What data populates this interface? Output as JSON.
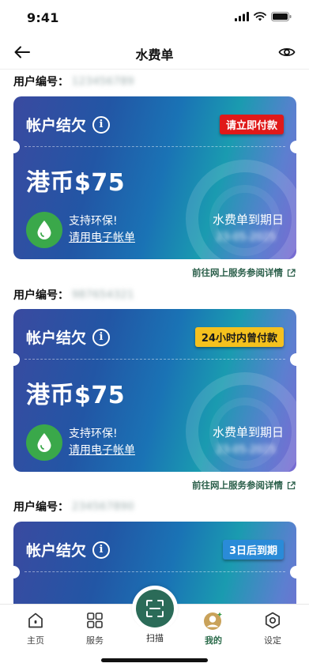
{
  "status_bar": {
    "time": "9:41"
  },
  "header": {
    "title": "水费单",
    "back_icon": "arrow-left-icon",
    "view_icon": "eye-icon"
  },
  "accounts": [
    {
      "label": "用户编号：",
      "number": "123456789",
      "card_title": "帐户结欠",
      "status_badge": "请立即付款",
      "status_color": "#e01919",
      "amount": "港币$75",
      "eco_line1": "支持环保!",
      "eco_link": "请用电子帐单",
      "due_label": "水费单到期日",
      "due_date": "23-05-2025",
      "portal_link": "前往网上服务参阅详情"
    },
    {
      "label": "用户编号：",
      "number": "987654321",
      "card_title": "帐户结欠",
      "status_badge": "24小时内曾付款",
      "status_color": "#f5c11e",
      "amount": "港币$75",
      "eco_line1": "支持环保!",
      "eco_link": "请用电子帐单",
      "due_label": "水费单到期日",
      "due_date": "23-05-2025",
      "portal_link": "前往网上服务参阅详情"
    },
    {
      "label": "用户编号：",
      "number": "234567890",
      "card_title": "帐户结欠",
      "status_badge": "3日后到期",
      "status_color": "#2a8bd8"
    }
  ],
  "bottom_nav": {
    "items": [
      {
        "label": "主页",
        "icon": "home-icon"
      },
      {
        "label": "服务",
        "icon": "grid-icon"
      },
      {
        "label": "扫描",
        "icon": "scan-icon"
      },
      {
        "label": "我的",
        "icon": "avatar-icon"
      },
      {
        "label": "设定",
        "icon": "settings-icon"
      }
    ],
    "active": "我的"
  }
}
